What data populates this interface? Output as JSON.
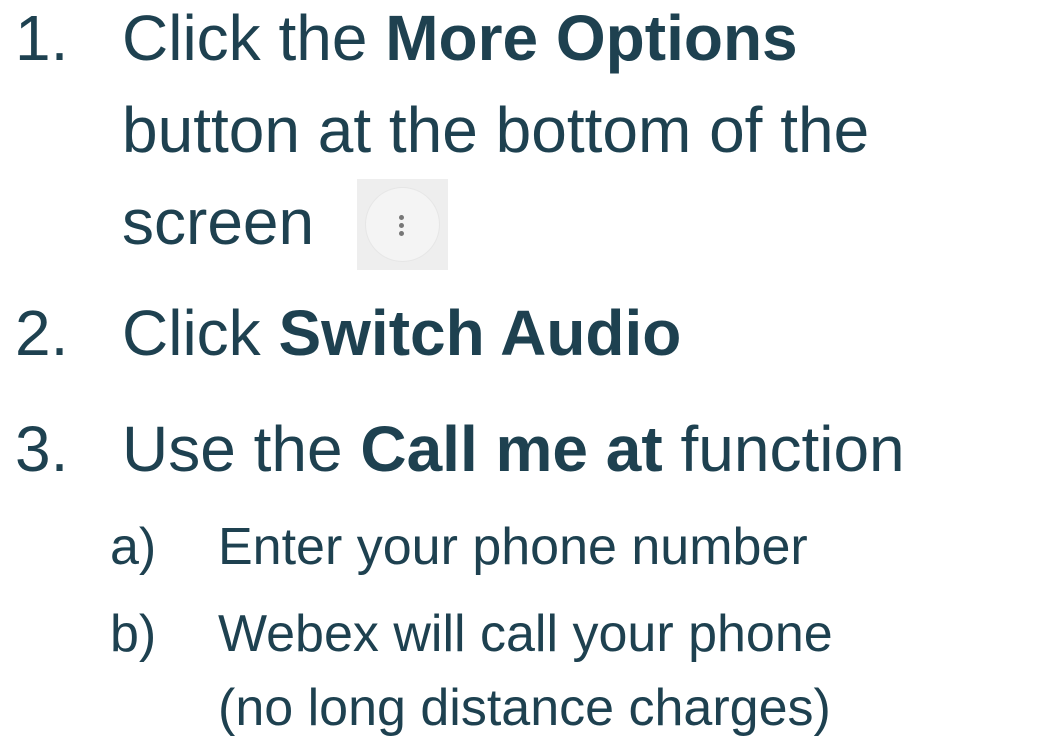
{
  "steps": [
    {
      "number": "1.",
      "pre": "Click the ",
      "bold": "More Options",
      "line2": "button at the bottom of the",
      "line3": "screen"
    },
    {
      "number": "2.",
      "pre": "Click ",
      "bold": "Switch Audio"
    },
    {
      "number": "3.",
      "pre": "Use the ",
      "bold": "Call me at",
      "post": " function"
    }
  ],
  "substeps": [
    {
      "marker": "a)",
      "text": "Enter your phone number"
    },
    {
      "marker": "b)",
      "text": "Webex will call your phone",
      "text2": "(no long distance charges)"
    }
  ],
  "colors": {
    "text": "#1e4150",
    "button_bg": "#eeeeee"
  },
  "icons": {
    "more_options": "vertical-ellipsis-icon"
  }
}
